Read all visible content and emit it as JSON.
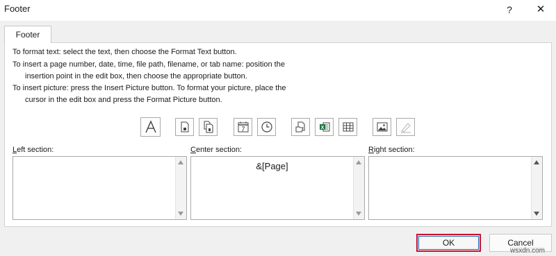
{
  "window": {
    "title": "Footer",
    "help_glyph": "?",
    "close_glyph": "✕"
  },
  "tabs": [
    {
      "label": "Footer",
      "active": true
    }
  ],
  "instructions": [
    "To format text:  select the text, then choose the Format Text button.",
    "To insert a page number, date, time, file path, filename, or tab name:  position the",
    "insertion point in the edit box, then choose the appropriate button.",
    "To insert picture: press the Insert Picture button.  To format your picture, place the",
    "cursor in the edit box and press the Format Picture button."
  ],
  "toolbar": [
    {
      "icon": "format-text-icon"
    },
    {
      "icon": "insert-page-number-icon"
    },
    {
      "icon": "insert-number-of-pages-icon"
    },
    {
      "icon": "insert-date-icon",
      "glyph": "7"
    },
    {
      "icon": "insert-time-icon"
    },
    {
      "icon": "insert-file-path-icon"
    },
    {
      "icon": "insert-file-name-icon",
      "glyph": "X"
    },
    {
      "icon": "insert-sheet-name-icon"
    },
    {
      "icon": "insert-picture-icon"
    },
    {
      "icon": "format-picture-icon",
      "disabled": true
    }
  ],
  "sections": {
    "left": {
      "accel": "L",
      "label_rest": "eft section:",
      "value": ""
    },
    "center": {
      "accel": "C",
      "label_rest": "enter section:",
      "value": "&[Page]"
    },
    "right": {
      "accel": "R",
      "label_rest": "ight section:",
      "value": ""
    }
  },
  "buttons": {
    "ok": "OK",
    "cancel": "Cancel"
  },
  "watermark": "wsxdn.com",
  "colors": {
    "highlight_border": "#c8102e",
    "focus_outline": "#1a5fb4",
    "excel_green": "#1e7145"
  }
}
